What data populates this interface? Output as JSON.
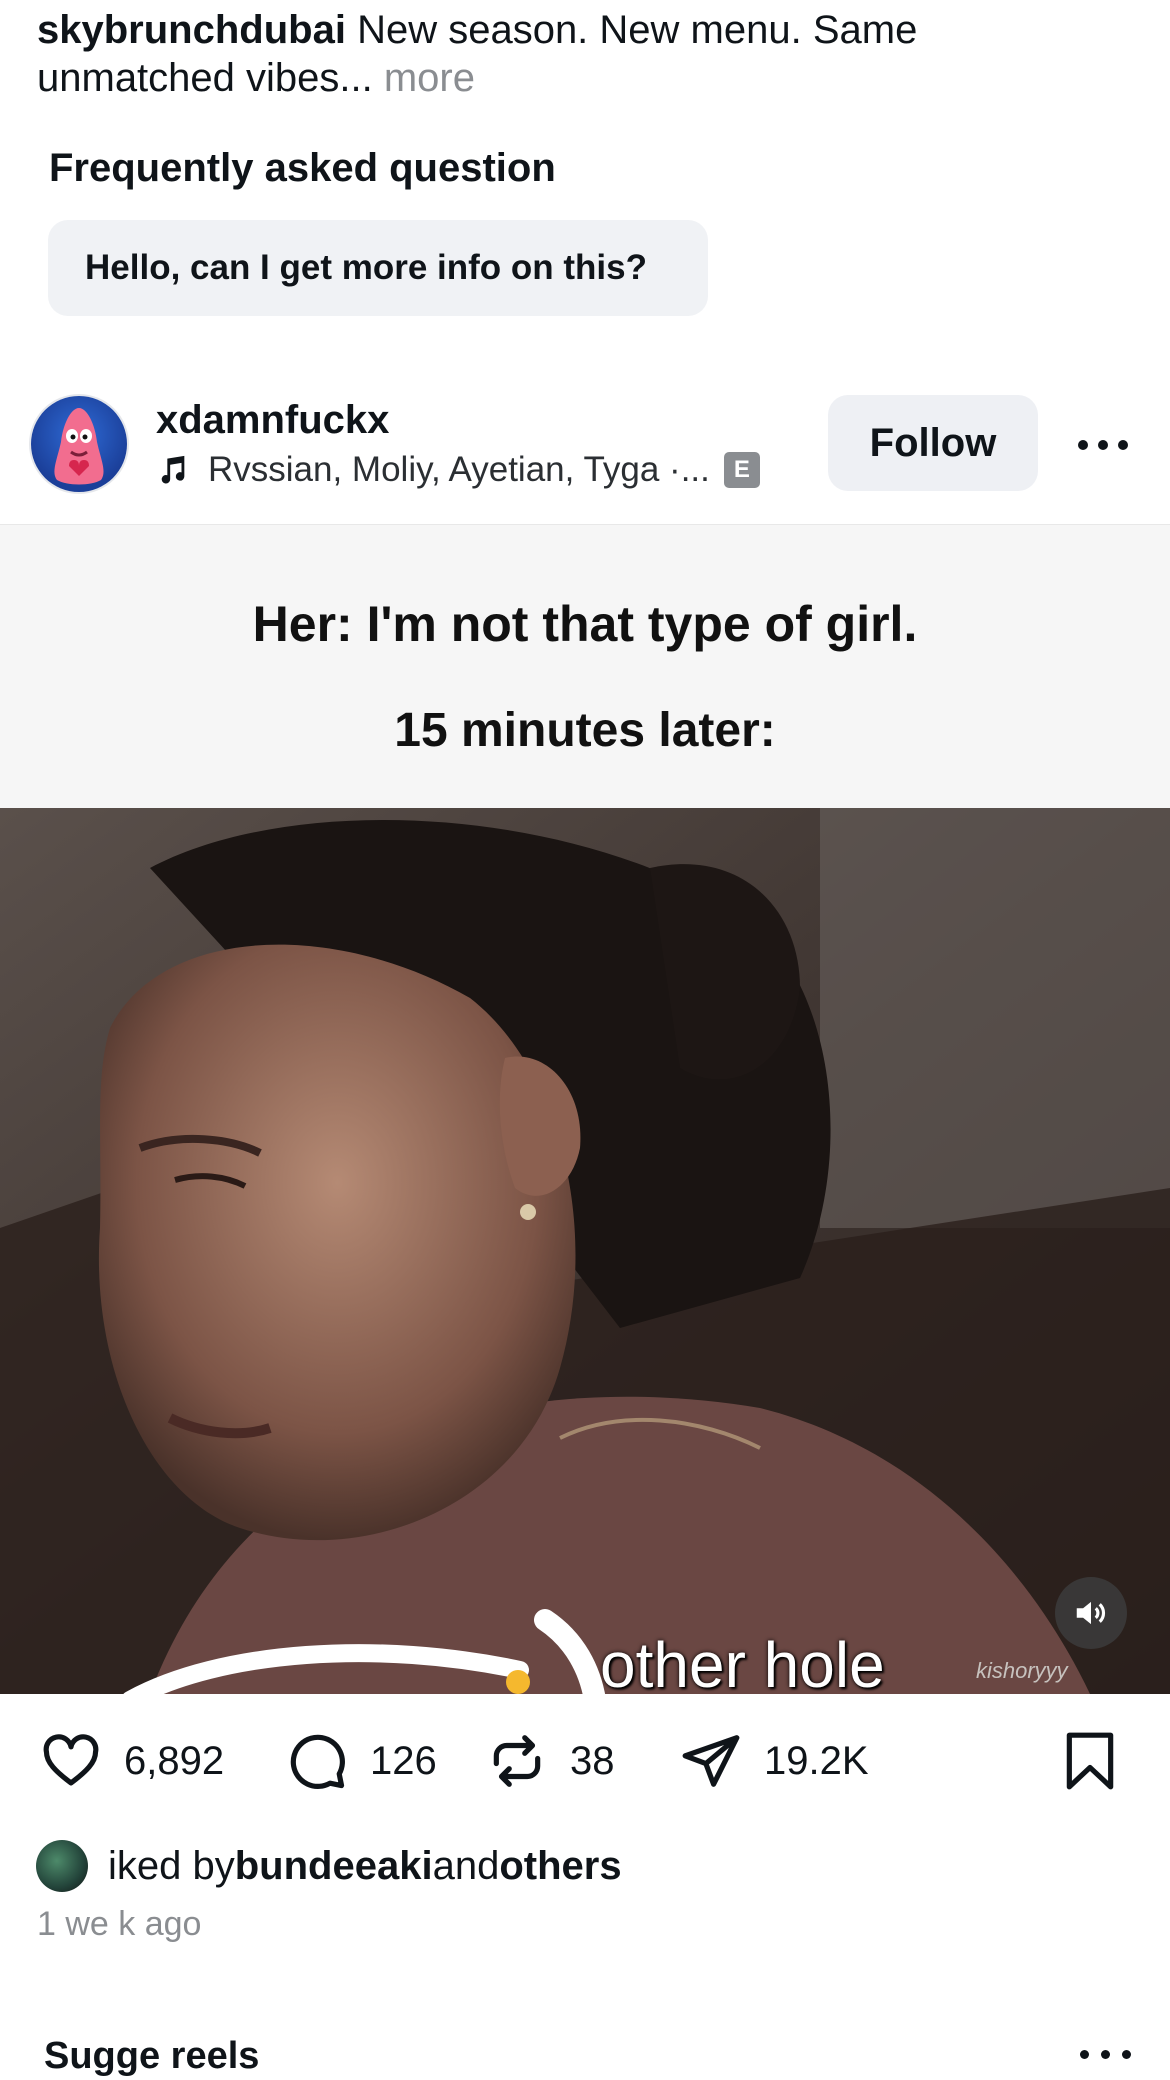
{
  "caption": {
    "username": "skybrunchdubai",
    "text": " New season. New menu. Same unmatched vibes...",
    "more_label": " more"
  },
  "faq": {
    "title": "Frequently asked question",
    "question": "Hello, can I get more info on this?"
  },
  "post": {
    "username": "xdamnfuckx",
    "audio": "Rvssian, Moliy, Ayetian, Tyga ·...",
    "explicit_badge": "E",
    "follow_label": "Follow",
    "media": {
      "text_line1": "Her: I'm not that type of girl.",
      "text_line2": "15 minutes later:",
      "subtitle": "other hole",
      "watermark": "kishoryyy"
    },
    "actions": {
      "likes": "6,892",
      "comments": "126",
      "reposts": "38",
      "shares": "19.2K"
    },
    "liked_by": {
      "prefix": "iked by ",
      "username": "bundeeaki",
      "middle": " and ",
      "suffix": "others"
    },
    "time_ago": "1 we  k ago"
  },
  "next_section": {
    "title": "Sugge    reels"
  },
  "colors": {
    "secondary_text": "#8a8d91",
    "chip_bg": "#f0f2f5",
    "follow_bg": "#eef0f4"
  }
}
